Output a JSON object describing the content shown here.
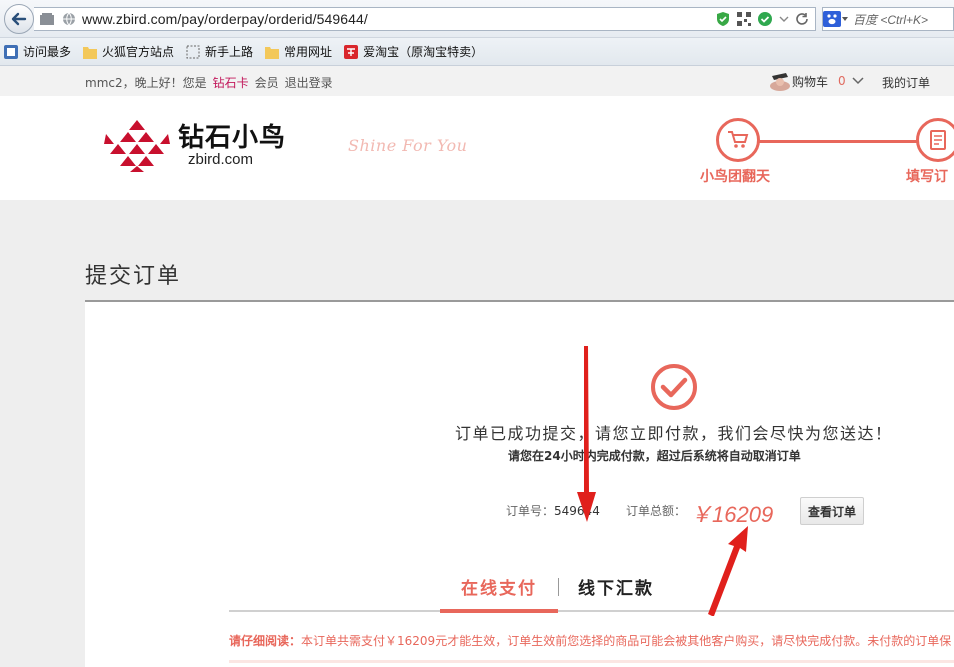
{
  "browser": {
    "url": "www.zbird.com/pay/orderpay/orderid/549644/",
    "search_placeholder": "百度 <Ctrl+K>"
  },
  "bookmarks": [
    {
      "label": "访问最多",
      "icon": "most-visited-icon"
    },
    {
      "label": "火狐官方站点",
      "icon": "folder-icon"
    },
    {
      "label": "新手上路",
      "icon": "dashed-folder-icon"
    },
    {
      "label": "常用网址",
      "icon": "folder-icon"
    },
    {
      "label": "爱淘宝（原淘宝特卖）",
      "icon": "taobao-icon"
    }
  ],
  "topbar": {
    "user": "mmc2，晚上好！您是",
    "member_level": "钻石卡",
    "member_suffix": "会员",
    "logout": "退出登录",
    "cart_label": "购物车",
    "cart_count": "0",
    "my_orders": "我的订单"
  },
  "header": {
    "logo_cn": "钻石小鸟",
    "logo_en": "zbird.com",
    "slogan": "Shine For You",
    "steps": [
      "小鸟团翻天",
      "填写订"
    ]
  },
  "main": {
    "title": "提交订单",
    "success_message": "订单已成功提交，请您立即付款，我们会尽快为您送达！",
    "deadline_message": "请您在24小时内完成付款，超过后系统将自动取消订单",
    "order_no_label": "订单号：",
    "order_no": "549644",
    "total_label": "订单总额：",
    "total_value": "￥16209",
    "view_order_button": "查看订单",
    "tabs": [
      "在线支付",
      "线下汇款"
    ],
    "notice_label": "请仔细阅读：",
    "notice_text": "本订单共需支付￥16209元才能生效，订单生效前您选择的商品可能会被其他客户购买，请尽快完成付款。未付款的订单保"
  },
  "colors": {
    "accent": "#e8675b",
    "member": "#c2185b"
  }
}
